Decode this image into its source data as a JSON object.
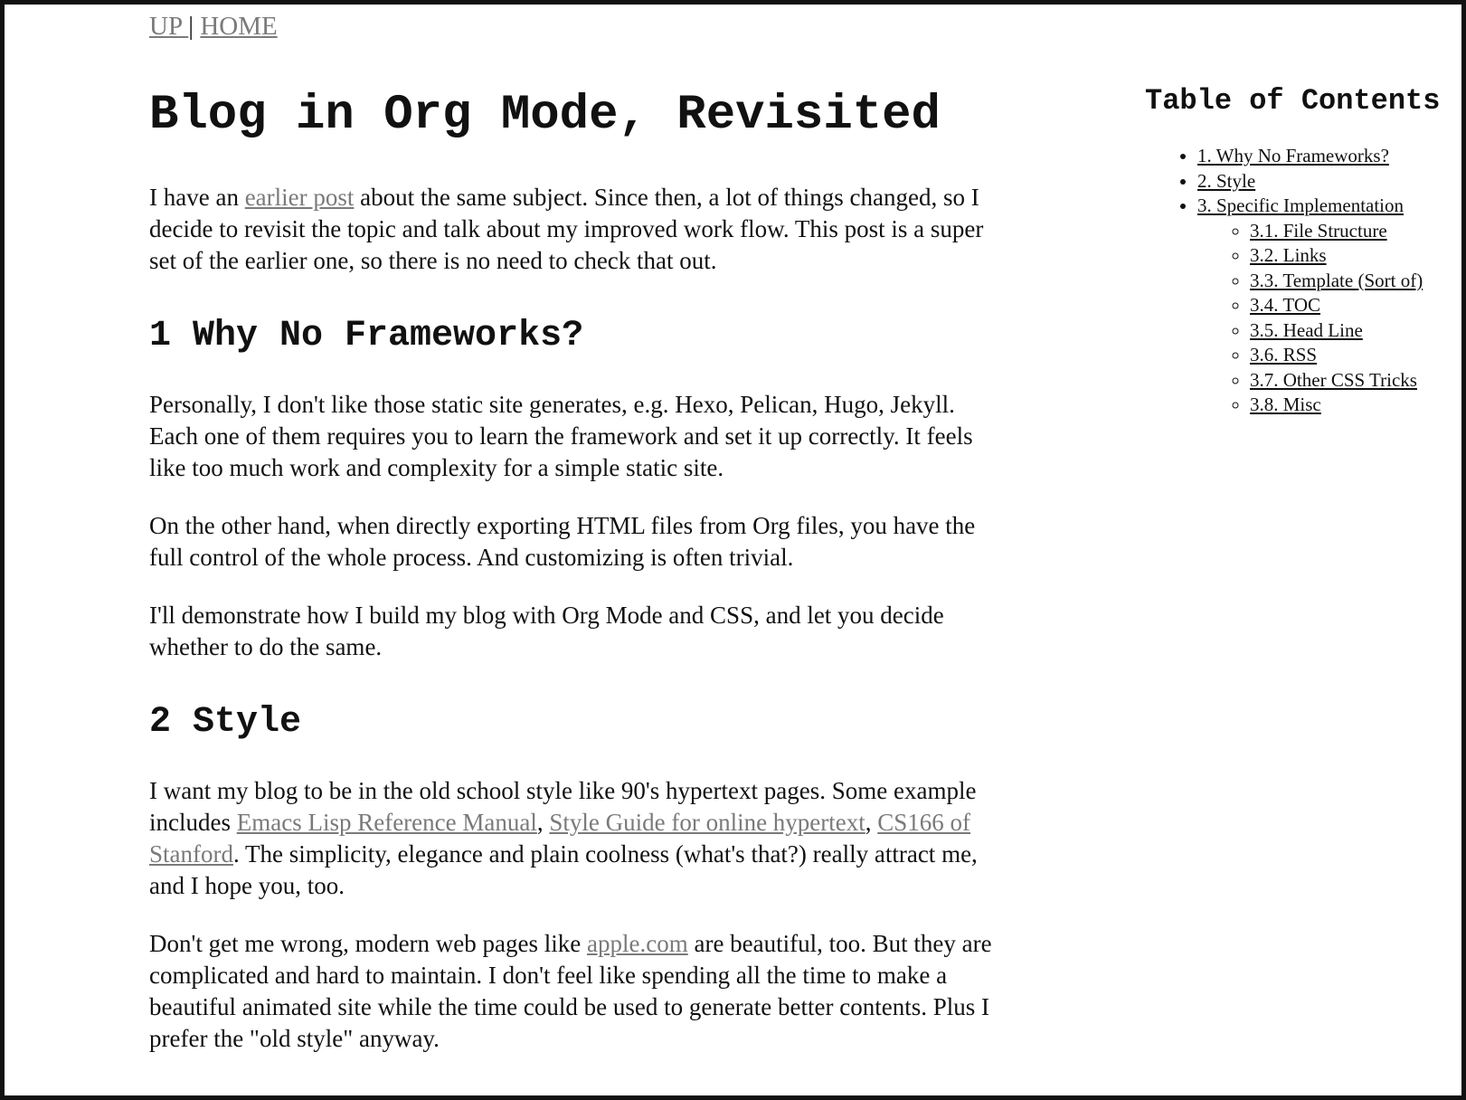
{
  "nav": {
    "up": "UP ",
    "sep": " | ",
    "home": "HOME"
  },
  "title": "Blog in Org Mode, Revisited",
  "intro": {
    "pre": "I have an ",
    "link": "earlier post",
    "post": " about the same subject. Since then, a lot of things changed, so I decide to revisit the topic and talk about my improved work flow. This post is a super set of the earlier one, so there is no need to check that out."
  },
  "section1": {
    "heading": "1 Why No Frameworks?",
    "p1": "Personally, I don't like those static site generates, e.g. Hexo, Pelican, Hugo, Jekyll. Each one of them requires you to learn the framework and set it up correctly. It feels like too much work and complexity for a simple static site.",
    "p2": "On the other hand, when directly exporting HTML files from Org files, you have the full control of the whole process. And customizing is often trivial.",
    "p3": "I'll demonstrate how I build my blog with Org Mode and CSS, and let you decide whether to do the same."
  },
  "section2": {
    "heading": "2 Style",
    "p1": {
      "pre": "I want my blog to be in the old school style like 90's hypertext pages. Some example includes ",
      "link1": "Emacs Lisp Reference Manual",
      "sep1": ", ",
      "link2": "Style Guide for online hypertext",
      "sep2": ", ",
      "link3": "CS166 of Stanford",
      "post": ". The simplicity, elegance and plain coolness (what's that?) really attract me, and I hope you, too."
    },
    "p2": {
      "pre": "Don't get me wrong, modern web pages like ",
      "link": "apple.com",
      "post": " are beautiful, too. But they are complicated and hard to maintain. I don't feel like spending all the time to make a beautiful animated site while the time could be used to generate better contents. Plus I prefer the \"old style\" anyway."
    }
  },
  "toc": {
    "title": "Table of Contents",
    "items": [
      "1. Why No Frameworks?",
      "2. Style",
      "3. Specific Implementation"
    ],
    "subitems": [
      "3.1. File Structure",
      "3.2. Links",
      "3.3. Template (Sort of)",
      "3.4. TOC",
      "3.5. Head Line",
      "3.6. RSS",
      "3.7. Other CSS Tricks",
      "3.8. Misc"
    ]
  }
}
